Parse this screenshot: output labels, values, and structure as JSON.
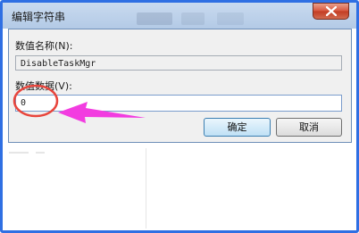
{
  "window": {
    "title": "编辑字符串"
  },
  "dialog": {
    "value_name_label": "数值名称(N):",
    "value_name": "DisableTaskMgr",
    "value_data_label": "数值数据(V):",
    "value_data": "0",
    "ok_label": "确定",
    "cancel_label": "取消"
  },
  "icons": {
    "close": "close-icon",
    "annotation_arrow": "arrow-icon"
  },
  "colors": {
    "frame": "#2f6fe3",
    "close_button": "#c23b22",
    "annotation_circle": "#e8453c",
    "annotation_arrow": "#f23ce0"
  }
}
